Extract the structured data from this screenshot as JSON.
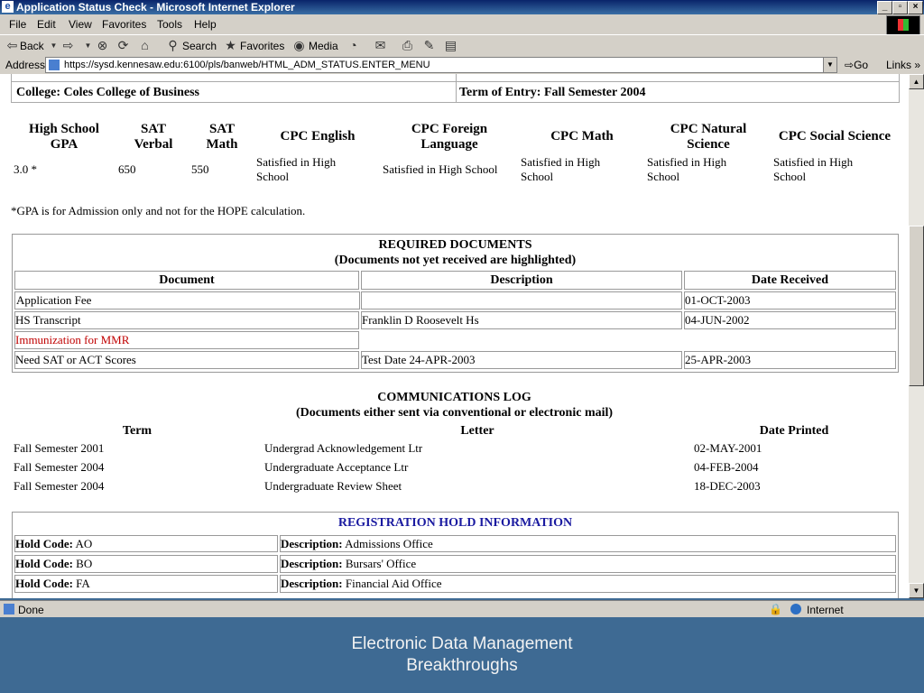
{
  "window": {
    "title": "Application Status Check - Microsoft Internet Explorer"
  },
  "menu": [
    "File",
    "Edit",
    "View",
    "Favorites",
    "Tools",
    "Help"
  ],
  "toolbar": {
    "back": "Back",
    "search": "Search",
    "favorites": "Favorites",
    "media": "Media"
  },
  "address": {
    "label": "Address",
    "url": "https://sysd.kennesaw.edu:6100/pls/banweb/HTML_ADM_STATUS.ENTER_MENU",
    "go": "Go",
    "links": "Links"
  },
  "top_info": {
    "college": "College: Coles College of Business",
    "term": "Term of Entry: Fall Semester 2004"
  },
  "scores": {
    "headers": [
      [
        "High School",
        "GPA"
      ],
      [
        "SAT",
        "Verbal"
      ],
      [
        "SAT",
        "Math"
      ],
      [
        "CPC English",
        ""
      ],
      [
        "CPC Foreign",
        "Language"
      ],
      [
        "CPC Math",
        ""
      ],
      [
        "CPC Natural",
        "Science"
      ],
      [
        "CPC Social Science",
        ""
      ]
    ],
    "values": [
      [
        "3.0 *",
        ""
      ],
      [
        "650",
        ""
      ],
      [
        "550",
        ""
      ],
      [
        "Satisfied in High",
        "School"
      ],
      [
        "Satisfied in High School",
        ""
      ],
      [
        "Satisfied in High",
        "School"
      ],
      [
        "Satisfied in High",
        "School"
      ],
      [
        "Satisfied in High",
        "School"
      ]
    ],
    "footnote": "*GPA is for Admission only and not for the HOPE calculation."
  },
  "required_docs": {
    "title": "REQUIRED DOCUMENTS",
    "subtitle": "(Documents not yet received are highlighted)",
    "columns": [
      "Document",
      "Description",
      "Date Received"
    ],
    "rows": [
      {
        "document": "Application Fee",
        "description": "",
        "date": "01-OCT-2003",
        "missing": false
      },
      {
        "document": "HS Transcript",
        "description": "Franklin D Roosevelt Hs",
        "date": "04-JUN-2002",
        "missing": false
      },
      {
        "document": "Immunization for MMR",
        "description": "",
        "date": "",
        "missing": true
      },
      {
        "document": "Need SAT or ACT Scores",
        "description": "Test Date 24-APR-2003",
        "date": "25-APR-2003",
        "missing": false
      }
    ]
  },
  "comm_log": {
    "title": "COMMUNICATIONS LOG",
    "subtitle": "(Documents either sent via conventional or electronic mail)",
    "columns": [
      "Term",
      "Letter",
      "Date Printed"
    ],
    "rows": [
      {
        "term": "Fall Semester 2001",
        "letter": "Undergrad Acknowledgement Ltr",
        "date": "02-MAY-2001"
      },
      {
        "term": "Fall Semester 2004",
        "letter": "Undergraduate Acceptance Ltr",
        "date": "04-FEB-2004"
      },
      {
        "term": "Fall Semester 2004",
        "letter": "Undergraduate Review Sheet",
        "date": "18-DEC-2003"
      }
    ]
  },
  "holds": {
    "title": "REGISTRATION HOLD INFORMATION",
    "code_label": "Hold Code:",
    "desc_label": "Description:",
    "rows": [
      {
        "code": "AO",
        "description": "Admissions Office"
      },
      {
        "code": "BO",
        "description": "Bursars' Office"
      },
      {
        "code": "FA",
        "description": "Financial Aid Office"
      }
    ]
  },
  "status": {
    "text": "Done",
    "zone": "Internet"
  },
  "caption": {
    "line1": "Electronic Data Management",
    "line2": "Breakthroughs"
  },
  "colors": {
    "accent_title": "#0a246a",
    "missing_doc": "#c00000",
    "hold_title": "#1a1aa0",
    "slide_bg": "#3e6a93"
  }
}
